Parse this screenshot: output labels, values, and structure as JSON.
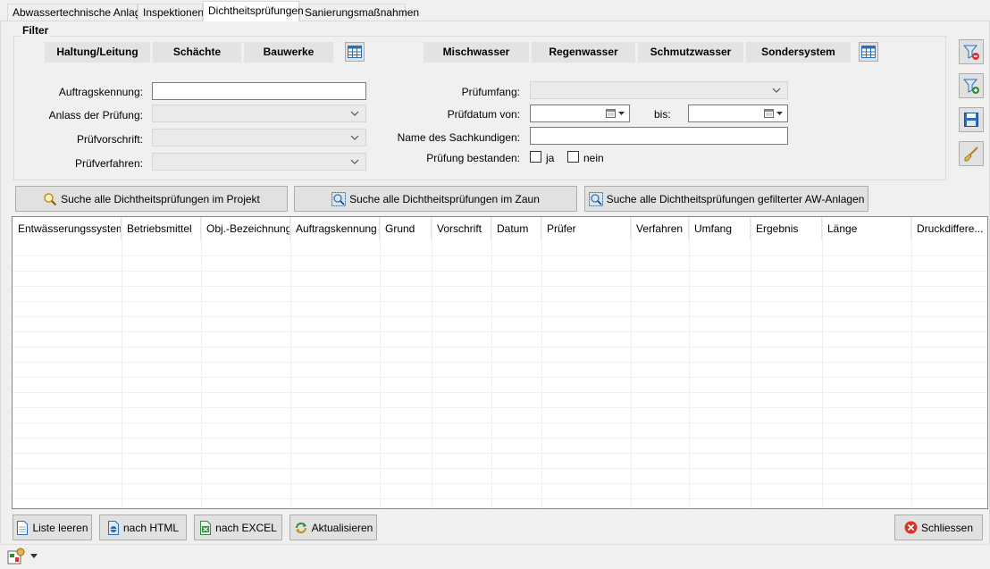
{
  "tabs": [
    "Abwassertechnische Anlage",
    "Inspektionen",
    "Dichtheitsprüfungen",
    "Sanierungsmaßnahmen"
  ],
  "filter": {
    "title": "Filter",
    "object_types": [
      "Haltung/Leitung",
      "Schächte",
      "Bauwerke"
    ],
    "systems": [
      "Mischwasser",
      "Regenwasser",
      "Schmutzwasser",
      "Sondersystem"
    ],
    "auftragskennung_label": "Auftragskennung:",
    "auftragskennung_value": "",
    "anlass_label": "Anlass der Prüfung:",
    "anlass_value": "",
    "pruefvorschrift_label": "Prüfvorschrift:",
    "pruefvorschrift_value": "",
    "pruefverfahren_label": "Prüfverfahren:",
    "pruefverfahren_value": "",
    "pruefumfang_label": "Prüfumfang:",
    "pruefumfang_value": "",
    "pruefdatum_von_label": "Prüfdatum von:",
    "pruefdatum_von_value": "",
    "bis_label": "bis:",
    "bis_value": "",
    "sachkundiger_label": "Name des Sachkundigen:",
    "sachkundiger_value": "",
    "bestanden_label": "Prüfung bestanden:",
    "ja_label": "ja",
    "nein_label": "nein"
  },
  "search_buttons": {
    "projekt": "Suche alle Dichtheitsprüfungen im Projekt",
    "zaun": "Suche alle Dichtheitsprüfungen im Zaun",
    "gefiltert": "Suche alle Dichtheitsprüfungen gefilterter AW-Anlagen"
  },
  "table": {
    "columns": [
      "Entwässerungssystem",
      "Betriebsmittel",
      "Obj.-Bezeichnung",
      "Auftragskennung",
      "Grund",
      "Vorschrift",
      "Datum",
      "Prüfer",
      "Verfahren",
      "Umfang",
      "Ergebnis",
      "Länge",
      "Druckdiffere..."
    ],
    "rows": []
  },
  "footer": {
    "liste_leeren": "Liste leeren",
    "nach_html": "nach HTML",
    "nach_excel": "nach EXCEL",
    "aktualisieren": "Aktualisieren",
    "schliessen": "Schliessen"
  },
  "icons": {
    "filter_remove": "filter-remove-icon",
    "filter_add": "filter-add-icon",
    "save": "save-icon",
    "brush": "brush-icon",
    "grid_select": "grid-select-icon",
    "search": "search-icon",
    "fence_search": "fence-search-icon",
    "list": "list-icon",
    "html": "html-icon",
    "excel": "excel-icon",
    "refresh": "refresh-icon",
    "close": "close-icon",
    "app": "app-icon"
  },
  "colors": {
    "window_bg": "#f0f0f0",
    "segment_bg": "#e3e3e3",
    "button_bg": "#e1e1e1",
    "accent_blue": "#2a6fb8",
    "excel_green": "#2e8b3a",
    "close_red": "#d9342b"
  }
}
